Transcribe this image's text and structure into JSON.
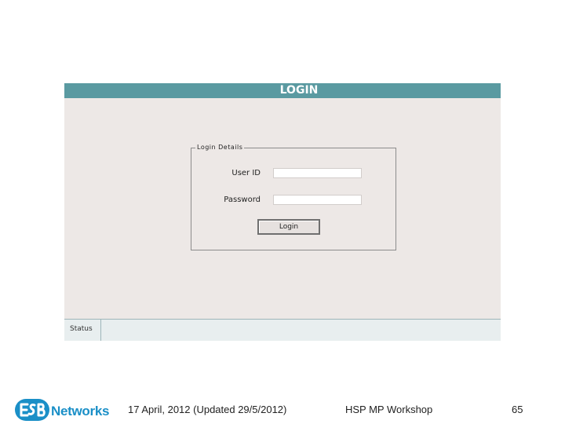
{
  "window": {
    "title": "LOGIN",
    "title_bar_color": "#5a9aa1"
  },
  "login_details": {
    "legend": "Login Details",
    "user_id_label": "User ID",
    "user_id_value": "",
    "password_label": "Password",
    "password_value": "",
    "login_button_label": "Login"
  },
  "status_bar": {
    "label": "Status"
  },
  "footer": {
    "logo_text": "Networks",
    "logo_icon": "esb-logo-icon",
    "date_text": "17 April, 2012 (Updated 29/5/2012)",
    "event_text": "HSP MP Workshop",
    "page_number": "65"
  },
  "colors": {
    "brand_blue": "#1a8fc7",
    "panel_background": "#ede8e6"
  }
}
